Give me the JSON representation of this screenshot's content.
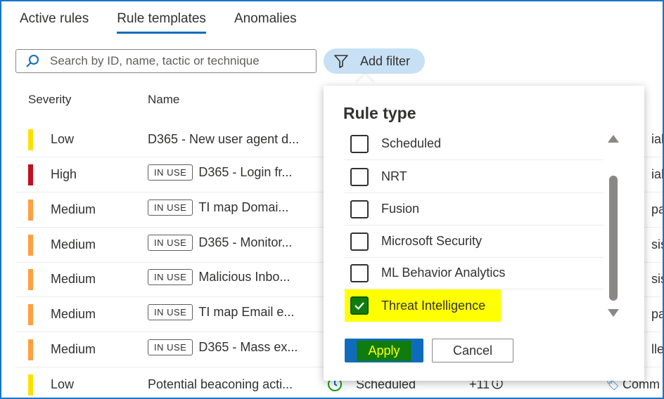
{
  "tabs": [
    {
      "label": "Active rules"
    },
    {
      "label": "Rule templates"
    },
    {
      "label": "Anomalies"
    }
  ],
  "search": {
    "placeholder": "Search by ID, name, tactic or technique"
  },
  "add_filter_label": "Add filter",
  "table": {
    "headers": {
      "severity": "Severity",
      "name": "Name"
    },
    "in_use_label": "IN USE",
    "rows": [
      {
        "severity": "Low",
        "name": "D365 - New user agent d...",
        "in_use": false,
        "right": "ial A"
      },
      {
        "severity": "High",
        "name": "D365 - Login fr...",
        "in_use": true,
        "right": "ial A"
      },
      {
        "severity": "Medium",
        "name": "TI map Domai...",
        "in_use": true,
        "right": "pact"
      },
      {
        "severity": "Medium",
        "name": "D365 - Monitor...",
        "in_use": true,
        "right": "sis..."
      },
      {
        "severity": "Medium",
        "name": "Malicious Inbo...",
        "in_use": true,
        "right": "sis..."
      },
      {
        "severity": "Medium",
        "name": "TI map Email e...",
        "in_use": true,
        "right": "pact"
      },
      {
        "severity": "Medium",
        "name": "D365 - Mass ex...",
        "in_use": true,
        "right": "llec."
      },
      {
        "severity": "Low",
        "name": "Potential beaconing acti...",
        "in_use": false,
        "right": "Comm"
      }
    ],
    "last_row_type": "Scheduled",
    "last_row_count": "+11"
  },
  "severity_colors": {
    "Low": "#fce100",
    "High": "#c50f1f",
    "Medium": "#ff9f40"
  },
  "panel": {
    "title": "Rule type",
    "options": [
      {
        "label": "Scheduled",
        "checked": false
      },
      {
        "label": "NRT",
        "checked": false
      },
      {
        "label": "Fusion",
        "checked": false
      },
      {
        "label": "Microsoft Security",
        "checked": false
      },
      {
        "label": "ML Behavior Analytics",
        "checked": false
      },
      {
        "label": "Threat Intelligence",
        "checked": true
      }
    ],
    "apply_label": "Apply",
    "cancel_label": "Cancel"
  }
}
